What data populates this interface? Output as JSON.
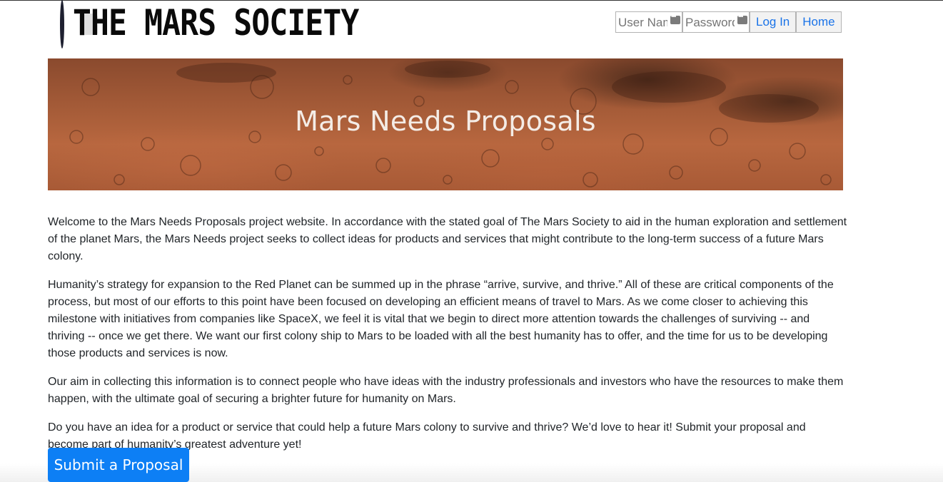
{
  "header": {
    "logo_text": "THE MARS SOCIETY",
    "username_placeholder": "User Name",
    "password_placeholder": "Password",
    "login_label": "Log In",
    "home_label": "Home",
    "link_color": "#1a73e8"
  },
  "hero": {
    "title": "Mars Needs Proposals"
  },
  "content": {
    "paragraphs": [
      "Welcome to the Mars Needs Proposals project website. In accordance with the stated goal of The Mars Society to aid in the human exploration and settlement of the planet Mars, the Mars Needs project seeks to collect ideas for products and services that might contribute to the long-term success of a future Mars colony.",
      "Humanity’s strategy for expansion to the Red Planet can be summed up in the phrase “arrive, survive, and thrive.” All of these are critical components of the process, but most of our efforts to this point have been focused on developing an efficient means of travel to Mars. As we come closer to achieving this milestone with initiatives from companies like SpaceX, we feel it is vital that we begin to direct more attention towards the challenges of surviving -- and thriving -- once we get there. We want our first colony ship to Mars to be loaded with all the best humanity has to offer, and the time for us to be developing those products and services is now.",
      "Our aim in collecting this information is to connect people who have ideas with the industry professionals and investors who have the resources to make them happen, with the ultimate goal of securing a brighter future for humanity on Mars.",
      "Do you have an idea for a product or service that could help a future Mars colony to survive and thrive? We’d love to hear it! Submit your proposal and become part of humanity’s greatest adventure yet!"
    ],
    "submit_label": "Submit a Proposal",
    "button_color": "#0d7ff5"
  }
}
